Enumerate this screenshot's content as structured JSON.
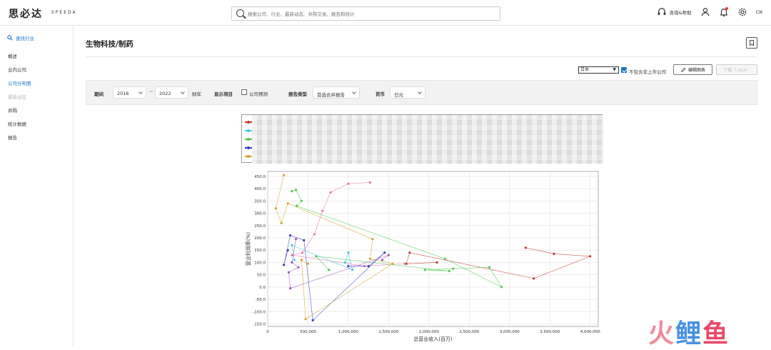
{
  "header": {
    "logo_text": "思必达",
    "logo_sub": "SPEEDA",
    "search_placeholder": "搜索公司、行业、最新动态、并购交易、报告和统计",
    "help_label": "咨询&帮助",
    "language": "CN"
  },
  "sidebar": {
    "find_label": "查找行业",
    "items": [
      {
        "label": "概述",
        "state": "normal"
      },
      {
        "label": "业内公司",
        "state": "normal"
      },
      {
        "label": "公司分布图",
        "state": "active"
      },
      {
        "label": "最新动态",
        "state": "disabled"
      },
      {
        "label": "并购",
        "state": "normal"
      },
      {
        "label": "统计数据",
        "state": "normal"
      },
      {
        "label": "报告",
        "state": "normal"
      }
    ]
  },
  "main": {
    "title": "生物科技/制药",
    "country": "日本",
    "exclude_unlisted_label": "不包含非上市公司",
    "exclude_unlisted_checked": true,
    "edit_chart_label": "编辑图表",
    "download_label": "下载（.xlsx）"
  },
  "filters": {
    "period_label": "期间",
    "period_from": "2016",
    "period_to": "2022",
    "fiscal_year_label": "财年",
    "display_label": "显示项目",
    "forecast_label": "公司预测",
    "forecast_checked": false,
    "report_type_label": "报告类型",
    "report_type_value": "首选合并报告",
    "currency_label": "货币",
    "currency_value": "日元"
  },
  "colors": {
    "accent": "#1a73c8",
    "series": [
      "#c0392b",
      "#3cc9e0",
      "#4ec94e",
      "#3b3bc9",
      "#d4a32a",
      "#e07aa0",
      "#9b59b6"
    ]
  },
  "chart_data": {
    "type": "scatter",
    "title": "",
    "xlabel": "总营业收入(百万)",
    "ylabel": "营业利润率(%)",
    "xlim": [
      0,
      4100000
    ],
    "ylim": [
      -160,
      470
    ],
    "xticks": [
      "0",
      "500,000",
      "1,000,000",
      "1,500,000",
      "2,000,000",
      "2,500,000",
      "3,000,000",
      "3,500,000",
      "4,000,000"
    ],
    "xtick_values": [
      0,
      500000,
      1000000,
      1500000,
      2000000,
      2500000,
      3000000,
      3500000,
      4000000
    ],
    "yticks": [
      "-150.0",
      "-100.0",
      "-50.0",
      "0.0",
      "50.0",
      "100.0",
      "150.0",
      "200.0",
      "250.0",
      "300.0",
      "350.0",
      "400.0",
      "450.0"
    ],
    "ytick_values": [
      -150,
      -100,
      -50,
      0,
      50,
      100,
      150,
      200,
      250,
      300,
      350,
      400,
      450
    ],
    "grid": true,
    "legend": "top, names obscured",
    "series": [
      {
        "color": "#c0392b",
        "points": [
          [
            3200000,
            160
          ],
          [
            3550000,
            135
          ],
          [
            4000000,
            125
          ],
          [
            3300000,
            35
          ],
          [
            1760000,
            140
          ],
          [
            1720000,
            95
          ],
          [
            2100000,
            100
          ]
        ]
      },
      {
        "color": "#e07aa0",
        "points": [
          [
            1270000,
            425
          ],
          [
            1000000,
            420
          ],
          [
            780000,
            385
          ],
          [
            680000,
            310
          ],
          [
            580000,
            215
          ],
          [
            430000,
            140
          ],
          [
            300000,
            130
          ],
          [
            1200000,
            85
          ],
          [
            1700000,
            95
          ]
        ]
      },
      {
        "color": "#4ec94e",
        "points": [
          [
            300000,
            390
          ],
          [
            350000,
            395
          ],
          [
            420000,
            350
          ],
          [
            360000,
            330
          ],
          [
            2200000,
            115
          ],
          [
            2900000,
            0
          ],
          [
            2750000,
            80
          ],
          [
            2300000,
            75
          ],
          [
            1950000,
            70
          ],
          [
            2250000,
            65
          ],
          [
            600000,
            125
          ],
          [
            760000,
            70
          ]
        ]
      },
      {
        "color": "#3cc9e0",
        "points": [
          [
            960000,
            100
          ],
          [
            1000000,
            140
          ],
          [
            1050000,
            70
          ],
          [
            300000,
            170
          ],
          [
            330000,
            110
          ]
        ]
      },
      {
        "color": "#3b3bc9",
        "points": [
          [
            250000,
            150
          ],
          [
            200000,
            90
          ],
          [
            280000,
            210
          ],
          [
            450000,
            190
          ],
          [
            560000,
            -135
          ],
          [
            1450000,
            140
          ],
          [
            1250000,
            85
          ],
          [
            1000000,
            85
          ]
        ]
      },
      {
        "color": "#d4a32a",
        "points": [
          [
            200000,
            455
          ],
          [
            100000,
            320
          ],
          [
            170000,
            260
          ],
          [
            250000,
            340
          ],
          [
            1300000,
            195
          ],
          [
            1270000,
            115
          ],
          [
            1550000,
            95
          ],
          [
            470000,
            -130
          ],
          [
            420000,
            110
          ],
          [
            500000,
            95
          ]
        ]
      },
      {
        "color": "#9b59b6",
        "points": [
          [
            350000,
            195
          ],
          [
            300000,
            100
          ],
          [
            380000,
            80
          ],
          [
            260000,
            60
          ],
          [
            280000,
            -5
          ],
          [
            1500000,
            130
          ],
          [
            1420000,
            110
          ]
        ]
      }
    ]
  }
}
